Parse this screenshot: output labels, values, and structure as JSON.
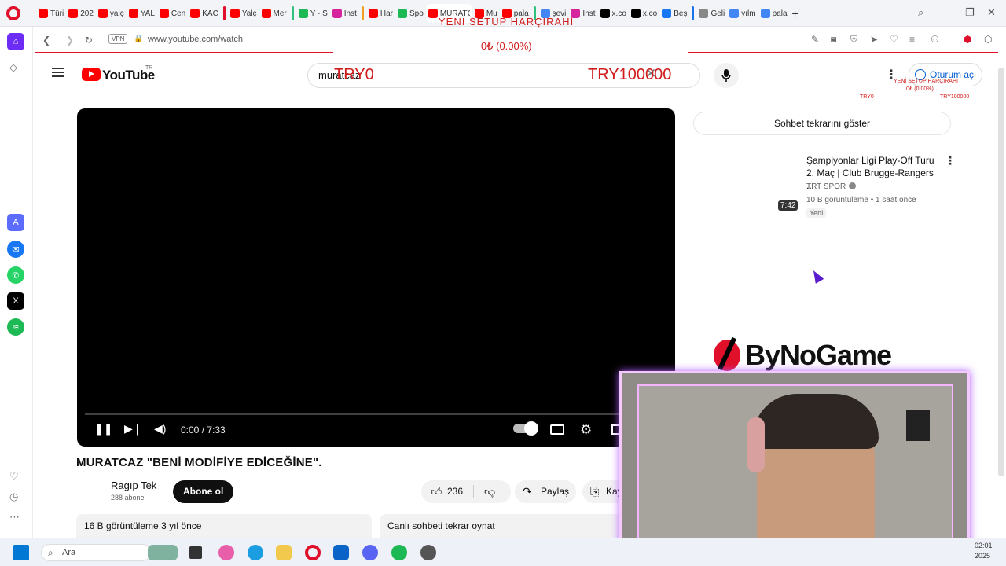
{
  "browser": {
    "tabs": [
      {
        "label": "Türi",
        "color": "#ff0000"
      },
      {
        "label": "202",
        "color": "#ff0000"
      },
      {
        "label": "yalç",
        "color": "#ff0000"
      },
      {
        "label": "YAL",
        "color": "#ff0000"
      },
      {
        "label": "Cen",
        "color": "#ff0000"
      },
      {
        "label": "KAC",
        "color": "#ff0000"
      },
      {
        "label": "Yalç",
        "color": "#ff0000"
      },
      {
        "label": "Mer",
        "color": "#ff0000"
      },
      {
        "label": "Y - S",
        "color": "#1db954"
      },
      {
        "label": "Inst",
        "color": "#d6249f"
      },
      {
        "label": "Har",
        "color": "#ff0000"
      },
      {
        "label": "Spo",
        "color": "#1db954"
      },
      {
        "label": "MURATC",
        "color": "#ff0000"
      },
      {
        "label": "Mu",
        "color": "#ff0000"
      },
      {
        "label": "pala",
        "color": "#ff0000"
      },
      {
        "label": "şevi",
        "color": "#4285f4"
      },
      {
        "label": "Inst",
        "color": "#d6249f"
      },
      {
        "label": "x.co",
        "color": "#000000"
      },
      {
        "label": "x.co",
        "color": "#000000"
      },
      {
        "label": "Beş",
        "color": "#1877f2"
      },
      {
        "label": "Geli",
        "color": "#888888"
      },
      {
        "label": "yılm",
        "color": "#4285f4"
      },
      {
        "label": "pala",
        "color": "#4285f4"
      }
    ],
    "address": "www.youtube.com/watch",
    "vpn_label": "VPN"
  },
  "youtube": {
    "logo_text": "YouTube",
    "region": "TR",
    "search_value": "muratcaz",
    "signin_label": "Oturum aç",
    "video_title": "MURATCAZ \"BENİ MODİFİYE EDİCEĞİNE\".",
    "time_display": "0:00 / 7:33",
    "channel_name": "Ragıp Tek",
    "subscribers": "288 abone",
    "subscribe_label": "Abone ol",
    "likes": "236",
    "share_label": "Paylaş",
    "save_label": "Kaydet",
    "views_line": "16 B görüntüleme  3 yıl önce",
    "replay_line": "Canlı sohbeti tekrar oynat",
    "chat_replay_label": "Sohbet tekrarını göster",
    "recommended": {
      "title": "Şampiyonlar Ligi Play-Off Turu 2. Maç | Club Brugge-Rangers ...",
      "channel": "TRT SPOR",
      "meta": "10 B görüntüleme • 1 saat önce",
      "badge": "Yeni",
      "duration": "7:42"
    }
  },
  "overlay": {
    "setup_text": "YENİ SETUP HARÇIRAHI",
    "percent_text": "0₺ (0.00%)",
    "goal_min": "TRY0",
    "goal_max": "TRY100000",
    "brand": "ByNoGame"
  },
  "taskbar": {
    "search_placeholder": "Ara",
    "time": "02:01",
    "date": "2025"
  }
}
